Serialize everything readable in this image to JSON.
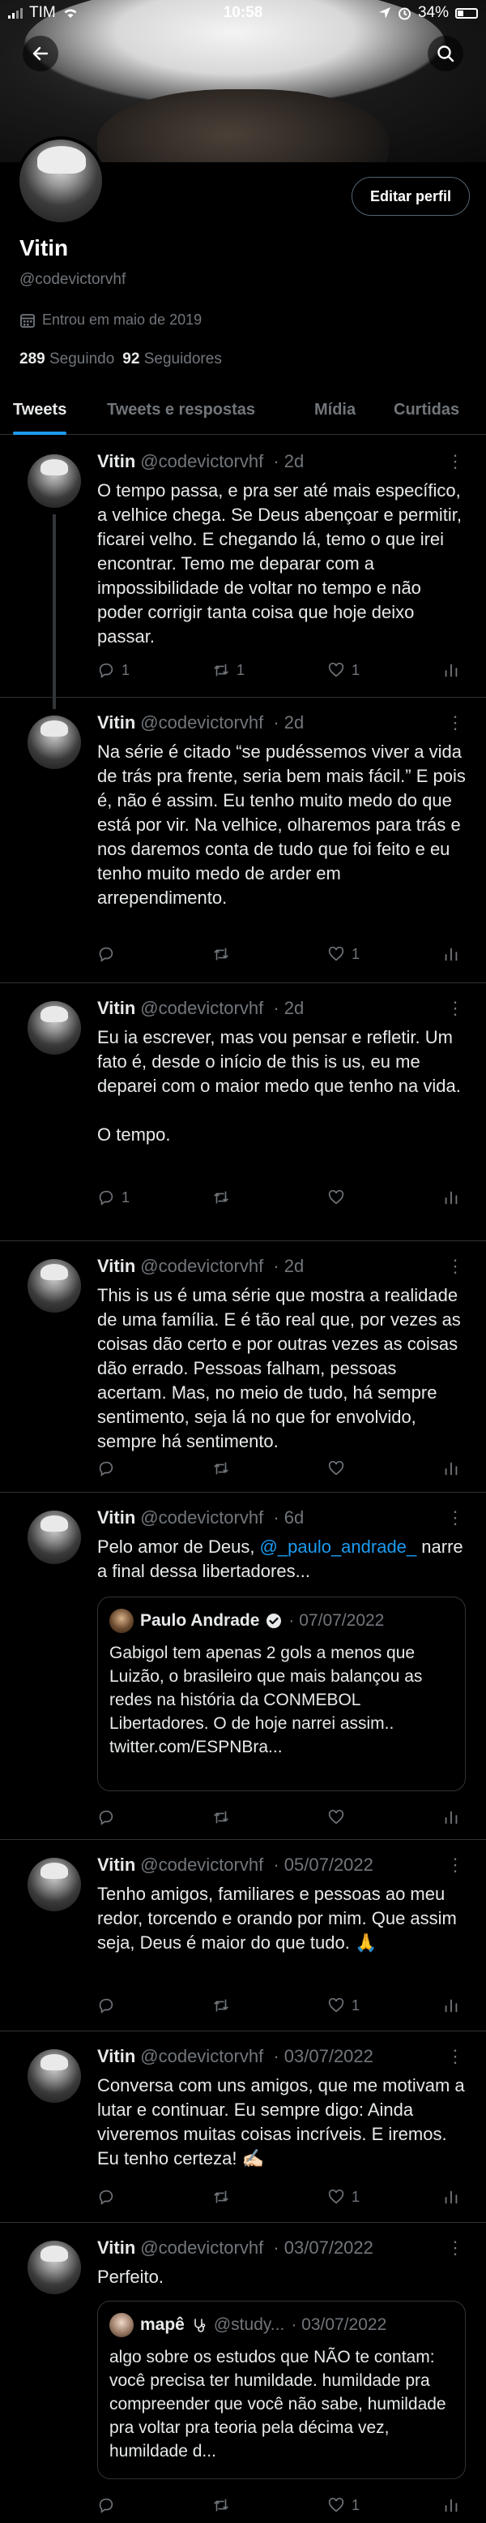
{
  "status_bar": {
    "carrier": "TIM",
    "time": "10:58",
    "battery": "34%"
  },
  "profile": {
    "name": "Vitin",
    "handle": "@codevictorvhf",
    "joined": "Entrou em maio de 2019",
    "following_count": "289",
    "following_label": "Seguindo",
    "followers_count": "92",
    "followers_label": "Seguidores",
    "edit_label": "Editar perfil"
  },
  "tabs": [
    {
      "label": "Tweets",
      "active": true
    },
    {
      "label": "Tweets e respostas",
      "active": false
    },
    {
      "label": "Mídia",
      "active": false
    },
    {
      "label": "Curtidas",
      "active": false
    }
  ],
  "tweets": [
    {
      "name": "Vitin",
      "handle": "@codevictorvhf",
      "date": "· 2d",
      "text": "O tempo passa, e pra ser até mais específico, a velhice chega. Se Deus abençoar e permitir, ficarei velho. E chegando lá, temo o que irei encontrar. Temo me deparar com a impossibilidade de voltar no tempo e não poder corrigir tanta coisa que hoje deixo passar.",
      "replies": "1",
      "retweets": "1",
      "likes": "1"
    },
    {
      "name": "Vitin",
      "handle": "@codevictorvhf",
      "date": "· 2d",
      "text": "Na série é citado “se pudéssemos viver a vida de trás pra frente, seria bem mais fácil.” E pois é, não é assim. Eu tenho muito medo do que está por vir. Na velhice, olharemos para trás e nos daremos conta de tudo que foi feito e eu tenho muito medo de arder em arrependimento.",
      "replies": "",
      "retweets": "",
      "likes": "1"
    },
    {
      "name": "Vitin",
      "handle": "@codevictorvhf",
      "date": "· 2d",
      "text": "Eu ia escrever, mas vou pensar e refletir. Um fato é, desde o início de this is us, eu me deparei com o maior medo que tenho na vida.\n\nO tempo.",
      "replies": "1",
      "retweets": "",
      "likes": ""
    },
    {
      "name": "Vitin",
      "handle": "@codevictorvhf",
      "date": "· 2d",
      "text": "This is us é uma série que mostra a realidade de uma família. E é tão real que, por vezes as coisas dão certo e por outras vezes as coisas dão errado. Pessoas falham, pessoas acertam. Mas, no meio de tudo, há sempre sentimento, seja lá no que for envolvido, sempre há sentimento.",
      "replies": "",
      "retweets": "",
      "likes": ""
    },
    {
      "name": "Vitin",
      "handle": "@codevictorvhf",
      "date": "· 6d",
      "text_before": "Pelo amor de Deus, ",
      "mention": "@_paulo_andrade_",
      "text_after": " narre a final dessa libertadores...",
      "quote": {
        "name": "Paulo Andrade",
        "date": "· 07/07/2022",
        "text": "Gabigol tem apenas 2 gols a menos que Luizão, o brasileiro que mais balançou as redes na história da CONMEBOL Libertadores. O de hoje narrei assim.. twitter.com/ESPNBra..."
      },
      "replies": "",
      "retweets": "",
      "likes": ""
    },
    {
      "name": "Vitin",
      "handle": "@codevictorvhf",
      "date": "· 05/07/2022",
      "text": "Tenho amigos, familiares e pessoas ao meu redor, torcendo e orando por mim. Que assim seja, Deus é maior do que tudo. 🙏",
      "replies": "",
      "retweets": "",
      "likes": "1"
    },
    {
      "name": "Vitin",
      "handle": "@codevictorvhf",
      "date": "· 03/07/2022",
      "text": "Conversa com uns amigos, que me motivam a lutar e continuar. Eu sempre digo: Ainda viveremos muitas coisas incríveis. E iremos. Eu tenho certeza! ✍🏻",
      "replies": "",
      "retweets": "",
      "likes": "1"
    },
    {
      "name": "Vitin",
      "handle": "@codevictorvhf",
      "date": "· 03/07/2022",
      "text": "Perfeito.",
      "quote": {
        "name": "mapê",
        "handle": "@study...",
        "date": "· 03/07/2022",
        "text": "algo sobre os estudos que NÃO te contam: você precisa ter humildade. humildade pra compreender que você não sabe, humildade pra voltar pra teoria pela décima vez, humildade d..."
      },
      "replies": "",
      "retweets": "",
      "likes": "1"
    }
  ],
  "colors": {
    "accent": "#1d9bf0",
    "text": "#e7e9ea",
    "muted": "#71767b",
    "border": "#2f3336",
    "background": "#000000"
  }
}
